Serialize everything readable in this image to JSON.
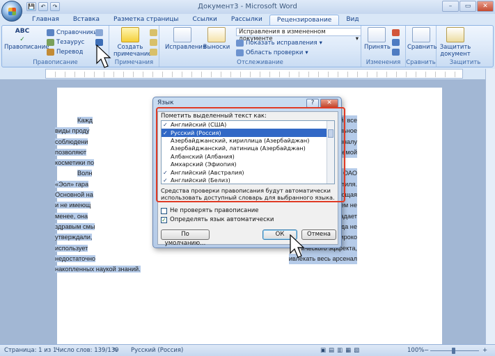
{
  "window": {
    "title": "Документ3 - Microsoft Word",
    "qat": [
      "💾",
      "↶",
      "↷"
    ],
    "controls": [
      "–",
      "▭",
      "✕"
    ]
  },
  "tabs": [
    "Главная",
    "Вставка",
    "Разметка страницы",
    "Ссылки",
    "Рассылки",
    "Рецензирование",
    "Вид"
  ],
  "ribbon": {
    "proofing": {
      "label": "Правописание",
      "spelling": "Правописание",
      "reference": "Справочники",
      "thesaurus": "Тезаурус",
      "translate": "Перевод"
    },
    "comments": {
      "label": "Примечания",
      "create_line1": "Создать",
      "create_line2": "примечание"
    },
    "tracking": {
      "label": "Отслеживание",
      "track_changes": "Исправления",
      "balloons": "Выноски",
      "display_value": "Исправления в измененном документе",
      "show_markup": "Показать исправления",
      "reviewing_pane": "Область проверки"
    },
    "changes": {
      "label": "Изменения",
      "accept": "Принять"
    },
    "compare": {
      "label": "Сравнить",
      "compare": "Сравнить"
    },
    "protect": {
      "label": "Защитить",
      "protect_line1": "Защитить",
      "protect_line2": "документ"
    }
  },
  "document": {
    "p1_left": "Кажд",
    "p1_right": "дской лабораторий; все",
    "lines_a": [
      "виды проду",
      "соблюдени",
      "позволяют",
      "косметики по"
    ],
    "lines_a_right": [
      "нтролю. Тщательное",
      "ребования к персоналу",
      "асность выпускаемой",
      ""
    ],
    "p2_left": "Волн",
    "p2_right": "огии, специалисты ОАО",
    "lines_b": [
      "«Эол» гара",
      "Основной на",
      "и не имеющ",
      "менее, она",
      "здравым смы",
      "утверждали,",
      "использует",
      "недостаточно"
    ],
    "lines_b_right": [
      "изысканность стиля.",
      "зачастую работающая",
      "еских салонов. Тем не",
      "о выглядеть, обладает",
      "итателя, мы никогда не",
      "миф, который широко",
      "ического эффекта,",
      "ивлекать весь арсенал"
    ],
    "last_line": "накопленных наукой знаний."
  },
  "dialog": {
    "title": "Язык",
    "help": "?",
    "close": "✕",
    "mark_label": "Пометить выделенный текст как:",
    "languages": [
      {
        "check": "✓",
        "name": "Английский (США)"
      },
      {
        "check": "✓",
        "name": "Русский (Россия)"
      },
      {
        "check": "",
        "name": "Азербайджанский, кириллица (Азербайджан)"
      },
      {
        "check": "",
        "name": "Азербайджанский, латиница (Азербайджан)"
      },
      {
        "check": "",
        "name": "Албанский (Албания)"
      },
      {
        "check": "",
        "name": "Амхарский (Эфиопия)"
      },
      {
        "check": "✓",
        "name": "Английский (Австралия)"
      },
      {
        "check": "✓",
        "name": "Английский (Белиз)"
      }
    ],
    "description": "Средства проверки правописания будут автоматически использовать доступный словарь для выбранного языка.",
    "no_proof": "Не проверять правописание",
    "auto_detect": "Определять язык автоматически",
    "auto_detect_checked": "✓",
    "default_btn": "По умолчанию...",
    "ok_btn": "ОК",
    "cancel_btn": "Отмена"
  },
  "status": {
    "page": "Страница: 1 из 1",
    "words": "Число слов: 139/139",
    "language": "Русский (Россия)",
    "zoom": "100%"
  },
  "colors": {
    "accent": "#15428b",
    "selection": "#3168c6",
    "highlight": "#b5cbe9",
    "red_frame": "#e03a24"
  }
}
